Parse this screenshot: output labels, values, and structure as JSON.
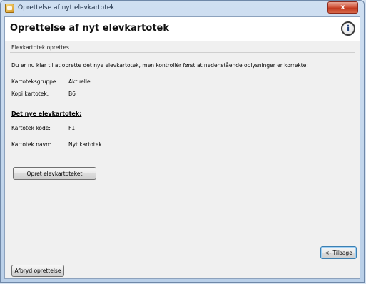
{
  "window": {
    "title": "Oprettelse af nyt elevkartotek",
    "close_glyph": "x"
  },
  "header": {
    "title": "Oprettelse af nyt elevkartotek",
    "info_glyph": "i"
  },
  "content": {
    "subtitle": "Elevkartotek oprettes",
    "intro": "Du er nu klar til at oprette det nye elevkartotek, men kontrollér først at nedenstående oplysninger er korrekte:",
    "fields": [
      {
        "label": "Kartoteksgruppe:",
        "value": "Aktuelle"
      },
      {
        "label": "Kopi kartotek:",
        "value": "B6"
      }
    ],
    "section_title": "Det nye elevkartotek:",
    "new_fields": [
      {
        "label": "Kartotek kode:",
        "value": "F1"
      },
      {
        "label": "Kartotek navn:",
        "value": "Nyt kartotek"
      }
    ]
  },
  "buttons": {
    "create": "Opret elevkartoteket",
    "back": "<- Tilbage",
    "abort": "Afbryd oprettelse"
  }
}
